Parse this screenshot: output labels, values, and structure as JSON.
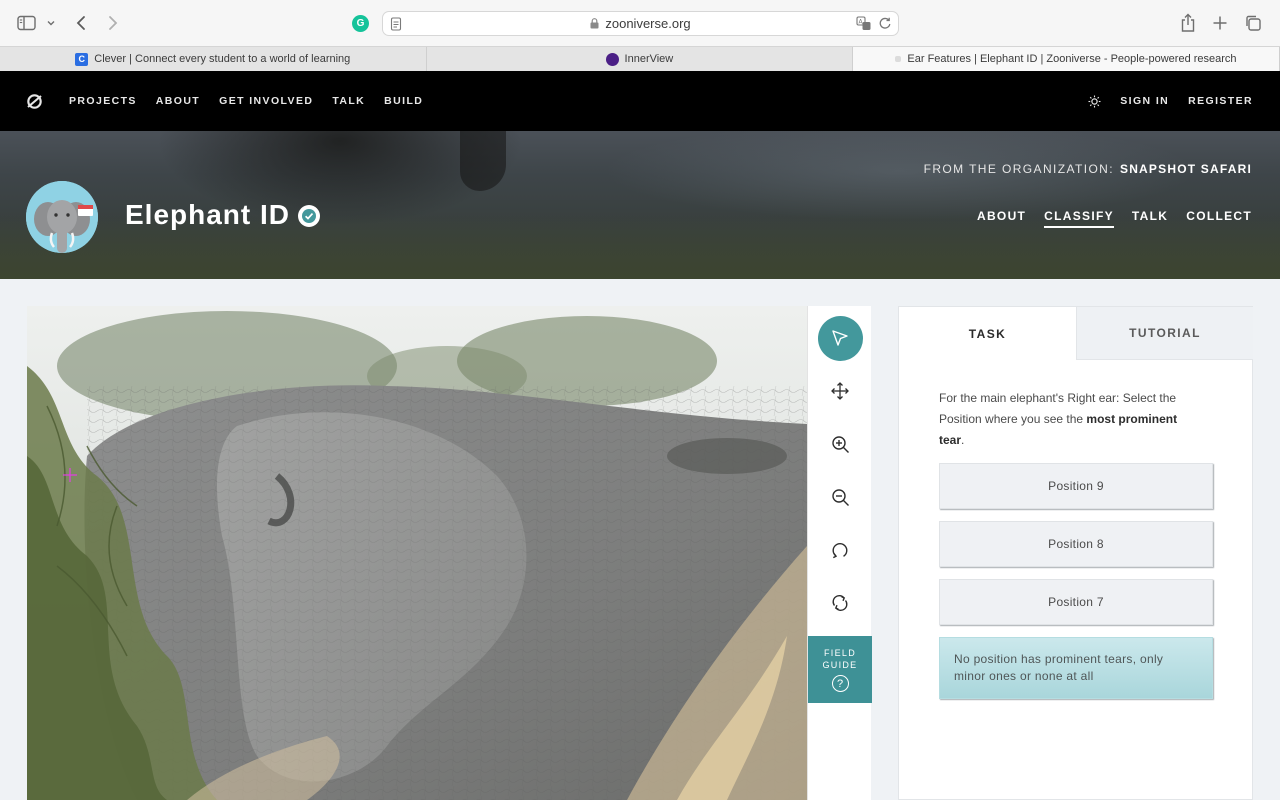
{
  "browser": {
    "url": "zooniverse.org",
    "tabs": [
      {
        "label": "Clever | Connect every student to a world of learning",
        "favicon": "clever-favicon"
      },
      {
        "label": "InnerView",
        "favicon": "innerview-favicon"
      },
      {
        "label": "Ear Features | Elephant ID | Zooniverse - People-powered research",
        "favicon": "zooniverse-favicon",
        "active": true
      }
    ]
  },
  "sitenav": {
    "links": [
      "PROJECTS",
      "ABOUT",
      "GET INVOLVED",
      "TALK",
      "BUILD"
    ],
    "sign_in": "SIGN IN",
    "register": "REGISTER"
  },
  "project": {
    "title": "Elephant ID",
    "org_prefix": "FROM THE ORGANIZATION:",
    "org_name": "SNAPSHOT SAFARI",
    "nav": [
      {
        "label": "ABOUT",
        "active": false
      },
      {
        "label": "CLASSIFY",
        "active": true
      },
      {
        "label": "TALK",
        "active": false
      },
      {
        "label": "COLLECT",
        "active": false
      }
    ]
  },
  "toolbar": {
    "tools": [
      "pointer-icon",
      "move-icon",
      "zoom-in-icon",
      "zoom-out-icon",
      "rotate-icon",
      "reset-icon"
    ],
    "field_guide_line1": "FIELD",
    "field_guide_line2": "GUIDE",
    "field_guide_icon": "?"
  },
  "task": {
    "tab_task": "TASK",
    "tab_tutorial": "TUTORIAL",
    "question_prefix": "For the main elephant's Right ear: Select the Position where you see the ",
    "question_bold": "most prominent tear",
    "question_suffix": ".",
    "answers": [
      "Position 9",
      "Position 8",
      "Position 7",
      "No position has prominent tears, only minor ones or none at all"
    ]
  },
  "colors": {
    "accent": "#43989c",
    "nav_bg": "#000000",
    "page_bg": "#eff2f5"
  }
}
